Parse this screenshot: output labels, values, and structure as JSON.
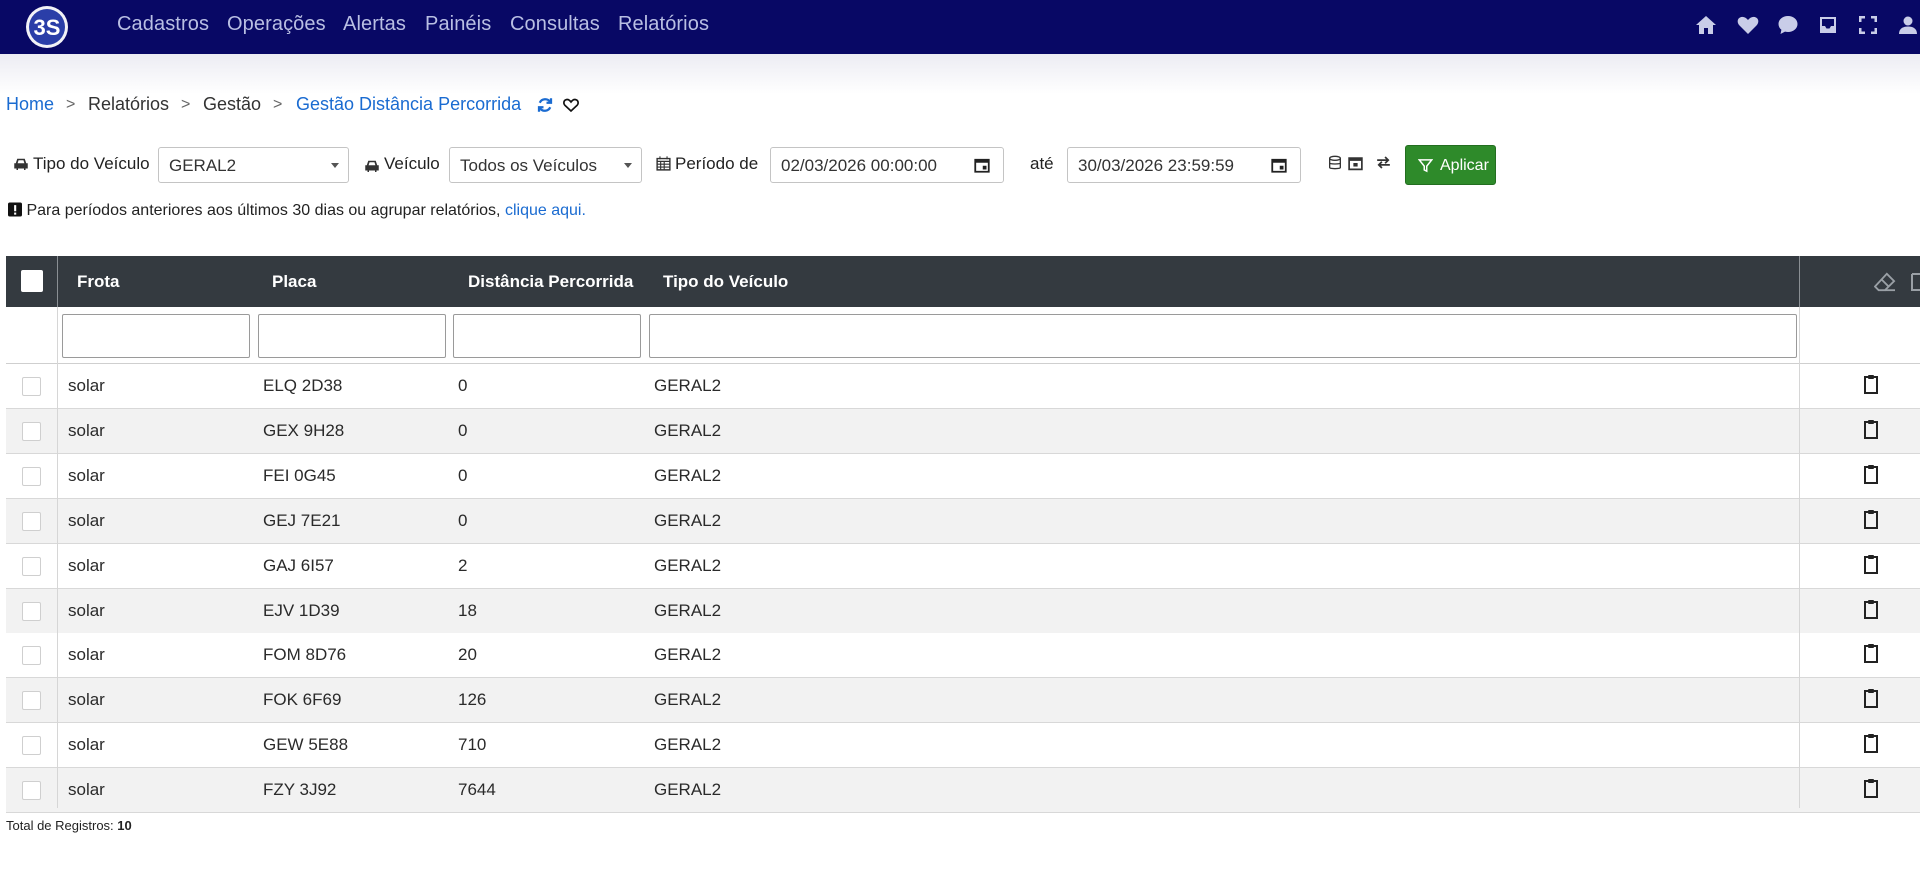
{
  "app": {
    "logo_text": "3S",
    "colors": {
      "navbar": "#080865",
      "accent_link": "#1a6bd1",
      "apply_button": "#2e8a2a",
      "table_header": "#343a40"
    }
  },
  "nav": {
    "items": [
      "Cadastros",
      "Operações",
      "Alertas",
      "Painéis",
      "Consultas",
      "Relatórios"
    ],
    "icons": [
      "home-icon",
      "heart-icon",
      "chat-icon",
      "inbox-icon",
      "fullscreen-icon",
      "user-icon"
    ]
  },
  "breadcrumb": {
    "items": [
      "Home",
      "Relatórios",
      "Gestão",
      "Gestão Distância Percorrida"
    ],
    "separator": ">"
  },
  "filters": {
    "vehicle_type_label": "Tipo do Veículo",
    "vehicle_type_value": "GERAL2",
    "vehicle_label": "Veículo",
    "vehicle_value": "Todos os Veículos",
    "period_label": "Período de",
    "period_from": "02/03/2026 00:00:00",
    "period_to_label": "até",
    "period_to": "30/03/2026 23:59:59",
    "apply_label": "Aplicar"
  },
  "notice": {
    "text": "Para períodos anteriores aos últimos 30 dias ou agrupar relatórios,",
    "link": "clique aqui."
  },
  "table": {
    "columns": [
      "Frota",
      "Placa",
      "Distância Percorrida",
      "Tipo do Veículo"
    ],
    "rows": [
      [
        "solar",
        "ELQ 2D38",
        "0",
        "GERAL2"
      ],
      [
        "solar",
        "GEX 9H28",
        "0",
        "GERAL2"
      ],
      [
        "solar",
        "FEI 0G45",
        "0",
        "GERAL2"
      ],
      [
        "solar",
        "GEJ 7E21",
        "0",
        "GERAL2"
      ],
      [
        "solar",
        "GAJ 6I57",
        "2",
        "GERAL2"
      ],
      [
        "solar",
        "EJV 1D39",
        "18",
        "GERAL2"
      ],
      [
        "solar",
        "FOM 8D76",
        "20",
        "GERAL2"
      ],
      [
        "solar",
        "FOK 6F69",
        "126",
        "GERAL2"
      ],
      [
        "solar",
        "GEW 5E88",
        "710",
        "GERAL2"
      ],
      [
        "solar",
        "FZY 3J92",
        "7644",
        "GERAL2"
      ]
    ]
  },
  "footer": {
    "total_label": "Total de Registros:",
    "total_value": "10"
  }
}
